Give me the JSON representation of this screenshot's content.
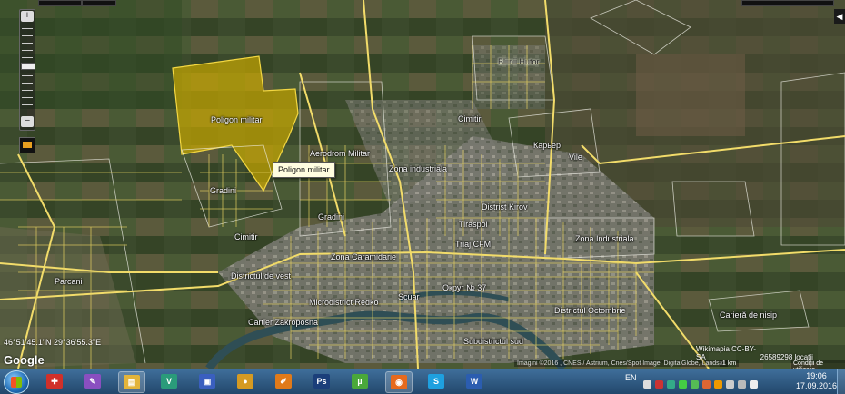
{
  "map": {
    "polygon_title": "Poligon militar",
    "tooltip": "Poligon militar",
    "labels": [
      {
        "id": "bliznii-hutor",
        "text": "Bliinii Hutor",
        "style": "dark"
      },
      {
        "id": "cimitir-ne",
        "text": "Cimitir"
      },
      {
        "id": "karier",
        "text": "Карьер"
      },
      {
        "id": "vile",
        "text": "Vile"
      },
      {
        "id": "aerodrom",
        "text": "Aerodrom Militar"
      },
      {
        "id": "zona-industriala-n",
        "text": "Zona industriala"
      },
      {
        "id": "districtul-kirov",
        "text": "Distrist Kirov"
      },
      {
        "id": "gradini-w",
        "text": "Gradini"
      },
      {
        "id": "gradini-c",
        "text": "Gradini"
      },
      {
        "id": "tiraspol",
        "text": "Tiraspol"
      },
      {
        "id": "triaj-cfm",
        "text": "Triaj CFM"
      },
      {
        "id": "zona-industriala-e",
        "text": "Zona Industriala"
      },
      {
        "id": "cimitir-w",
        "text": "Cimitir"
      },
      {
        "id": "zona-caramidarie",
        "text": "Zona Caramidarie"
      },
      {
        "id": "districtul-de-vest",
        "text": "Districtul de vest"
      },
      {
        "id": "parcani",
        "text": "Parcani"
      },
      {
        "id": "ocrug-37",
        "text": "Округ № 37"
      },
      {
        "id": "microdistrict-redko",
        "text": "Microdistrict Redko"
      },
      {
        "id": "scuar",
        "text": "Scuar"
      },
      {
        "id": "districtul-octombrie",
        "text": "Districtul Octombrie"
      },
      {
        "id": "cartier-zakroposna",
        "text": "Cartier Zakroposna"
      },
      {
        "id": "cariera-de-nisip",
        "text": "Carieră de nisip"
      },
      {
        "id": "subdistrictul-sud",
        "text": "Subdistrictul sud"
      }
    ],
    "coordinates": "46°51'45.1\"N 29°36'55.3\"E",
    "google_logo": "Google",
    "credits": "Imagini ©2016 , CNES / Astrium, Cnes/Spot Image, DigitalGlobe, Landsat",
    "wikimapia": "Wikimapia CC-BY-SA",
    "locations_count": "26589298 locații",
    "scale": "1 km",
    "terms": "Condiții de utilizare",
    "zoom_in": "+",
    "zoom_out": "−",
    "side_tab": "◀"
  },
  "taskbar": {
    "language": "EN",
    "time": "19:06",
    "date": "17.09.2016",
    "apps": [
      {
        "id": "start",
        "name": "Start"
      },
      {
        "id": "app-red",
        "name": "app",
        "glyph": "✚",
        "color": "#d0302a"
      },
      {
        "id": "app-purple",
        "name": "app",
        "glyph": "✎",
        "color": "#8a4fc0"
      },
      {
        "id": "explorer",
        "name": "Explorer",
        "glyph": "▤",
        "color": "#e3b43a"
      },
      {
        "id": "vim",
        "name": "app",
        "glyph": "V",
        "color": "#2a9b7a"
      },
      {
        "id": "save",
        "name": "app",
        "glyph": "▣",
        "color": "#3a5fbf"
      },
      {
        "id": "lock",
        "name": "app",
        "glyph": "●",
        "color": "#d59a22"
      },
      {
        "id": "draw",
        "name": "app",
        "glyph": "✐",
        "color": "#e07a1a"
      },
      {
        "id": "photoshop",
        "name": "Ps",
        "glyph": "Ps",
        "color": "#1b3f7a"
      },
      {
        "id": "torrent",
        "name": "uTorrent",
        "glyph": "µ",
        "color": "#4aa83a"
      },
      {
        "id": "firefox",
        "name": "Firefox",
        "glyph": "◉",
        "color": "#e66a1e"
      },
      {
        "id": "skype",
        "name": "Skype",
        "glyph": "S",
        "color": "#1ea0e0"
      },
      {
        "id": "word",
        "name": "Word",
        "glyph": "W",
        "color": "#2b5db0"
      }
    ]
  }
}
